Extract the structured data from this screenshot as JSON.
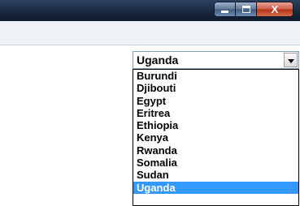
{
  "window": {
    "controls": {
      "minimize_icon": "minimize-icon",
      "maximize_icon": "maximize-icon",
      "close_label": "X"
    }
  },
  "country_select": {
    "value": "Uganda",
    "options": [
      "Burundi",
      "Djibouti",
      "Egypt",
      "Eritrea",
      "Ethiopia",
      "Kenya",
      "Rwanda",
      "Somalia",
      "Sudan",
      "Uganda"
    ],
    "selected_index": 9
  },
  "colors": {
    "selection": "#3399ff",
    "titlebar": "#1c2d44",
    "close_button": "#c44a2e"
  }
}
